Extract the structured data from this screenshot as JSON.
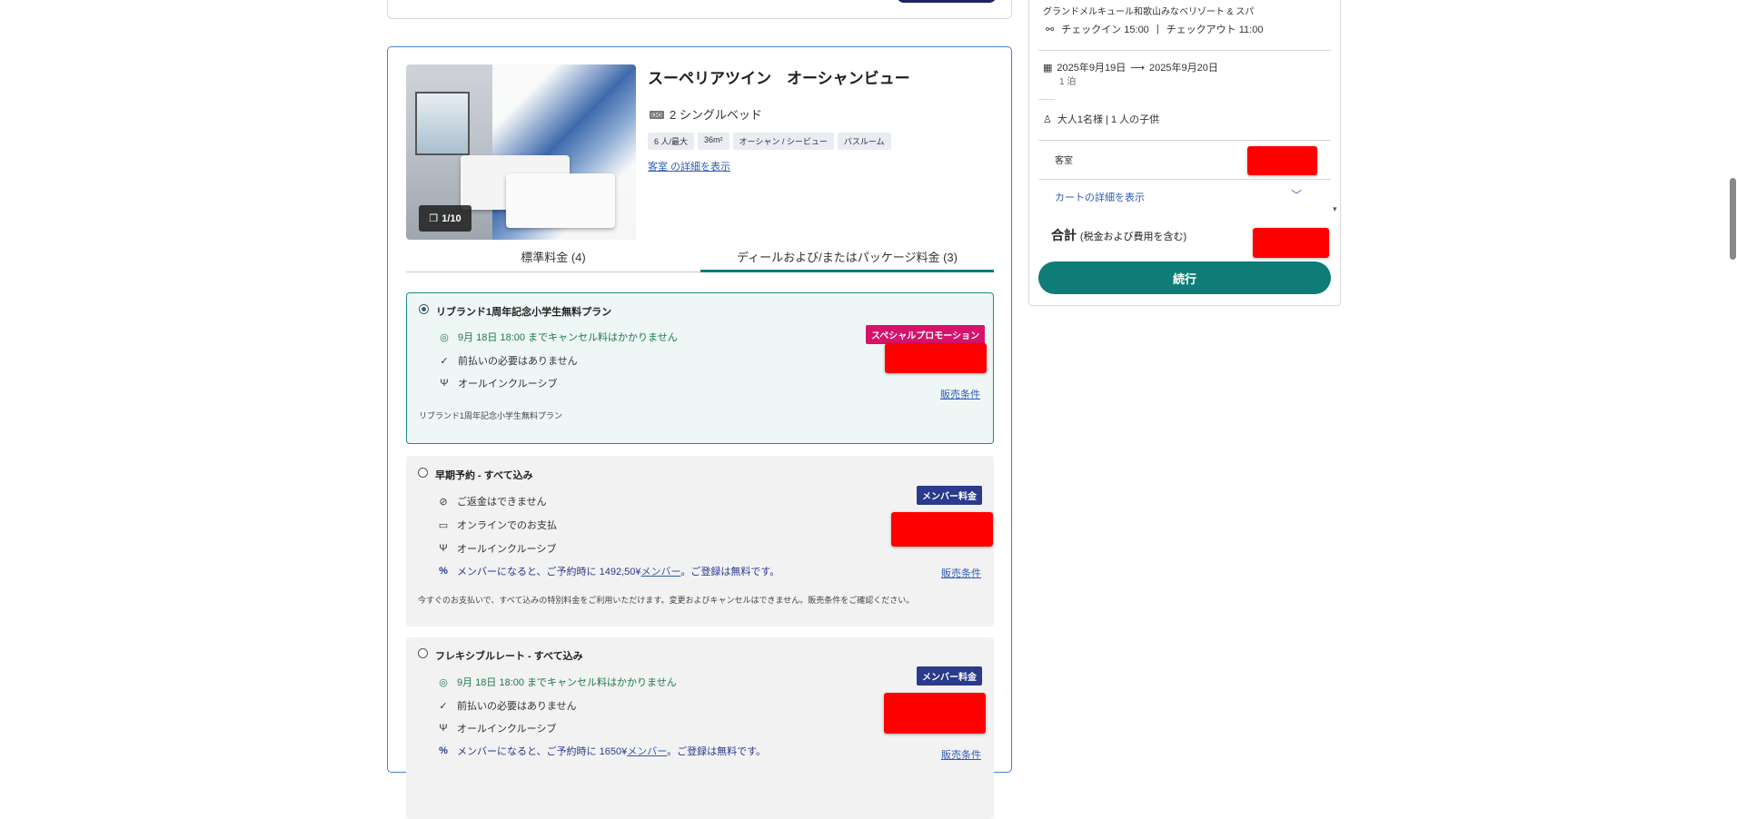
{
  "room": {
    "title": "スーペリアツイン　オーシャンビュー",
    "bed": "2 シングルベッド",
    "tags": [
      "6 人/最大",
      "36m²",
      "オーシャン / シービュー",
      "バスルーム"
    ],
    "details_link": "客室 の詳細を表示",
    "photo_counter": "1/10"
  },
  "tabs": {
    "standard": "標準料金 (4)",
    "deals": "ディールおよび/またはパッケージ料金 (3)"
  },
  "plans": [
    {
      "title": "リブランド1周年記念小学生無料プラン",
      "cancel": "9月 18日 18:00 までキャンセル料はかかりません",
      "prepay": "前払いの必要はありません",
      "meal": "オールインクルーシブ",
      "badge": "スペシャルプロモーション",
      "terms": "販売条件",
      "note": "リブランド1周年記念小学生無料プラン"
    },
    {
      "title": "早期予約 - すべて込み",
      "refund": "ご返金はできません",
      "payment": "オンラインでのお支払",
      "meal": "オールインクルーシブ",
      "member_pre": "メンバーになると、ご予約時に 1492,50¥",
      "member_link": "メンバー",
      "member_post": "。ご登録は無料です。",
      "badge": "メンバー料金",
      "terms": "販売条件",
      "note": "今すぐのお支払いで、すべて込みの特別料金をご利用いただけます。変更およびキャンセルはできません。販売条件をご確認ください。"
    },
    {
      "title": "フレキシブルレート - すべて込み",
      "cancel": "9月 18日 18:00 までキャンセル料はかかりません",
      "prepay": "前払いの必要はありません",
      "meal": "オールインクルーシブ",
      "member_pre": "メンバーになると、ご予約時に 1650¥",
      "member_link": "メンバー",
      "member_post": "。ご登録は無料です。",
      "badge": "メンバー料金",
      "terms": "販売条件"
    }
  ],
  "summary": {
    "hotel": "グランドメルキュール和歌山みなベリゾート & スパ",
    "checkin": "チェックイン 15:00",
    "checkout": "チェックアウト 11:00",
    "date_from": "2025年9月19日",
    "date_to": "2025年9月20日",
    "nights": "1 泊",
    "guests": "大人1名様 | 1 人の子供",
    "room_label": "客室",
    "cart_link": "カートの詳細を表示",
    "total_label": "合計",
    "total_sub": "(税金および費用を含む)",
    "continue": "続行"
  },
  "colors": {
    "accent": "#0e7c77",
    "link": "#2e5cb8",
    "promo": "#d8126a",
    "member": "#2a3a8c",
    "redacted": "#ff0000"
  }
}
